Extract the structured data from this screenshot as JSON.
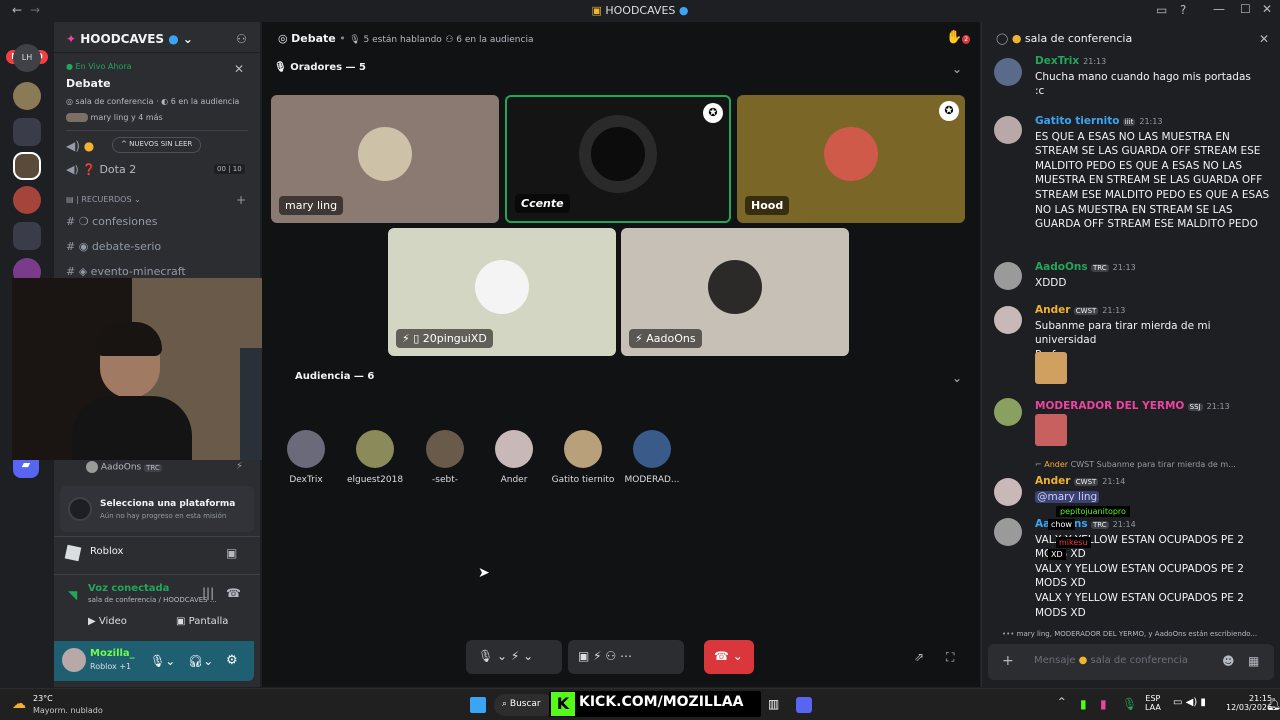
{
  "window": {
    "title": "HOODCAVES",
    "icons": [
      "back-arrow",
      "forward-arrow",
      "inbox-icon",
      "help-icon",
      "minimize",
      "maximize",
      "close"
    ]
  },
  "guilds": {
    "new_badge": "NUEVO",
    "unread_badge": "LH"
  },
  "sidebar": {
    "server_name": "HOODCAVES",
    "live_label": "En Vivo Ahora",
    "stage_name": "Debate",
    "stage_channel": "sala de conferencia",
    "stage_audience": "6 en la audiencia",
    "stage_members": "mary ling y 4 más",
    "new_unread": "NUEVOS SIN LEER",
    "dota": "Dota 2",
    "dota_count_a": "00",
    "dota_count_b": "10",
    "category": "| RECUERDOS",
    "channels": [
      "confesiones",
      "debate-serio",
      "evento-minecraft"
    ],
    "voice_user": "AadoOns",
    "voice_user_tag": "TRC",
    "platform_title": "Selecciona una plataforma",
    "platform_sub": "Aún no hay progreso en esta misión",
    "game": "Roblox",
    "voice_status": "Voz conectada",
    "voice_channel": "sala de conferencia / HOODCAVES ...",
    "video_btn": "Video",
    "screen_btn": "Pantalla",
    "self_name": "Mozilla_",
    "self_status": "Roblox +1"
  },
  "stage": {
    "title": "Debate",
    "speaking": "5 están hablando",
    "audience": "6 en la audiencia",
    "speakers_header": "Oradores — 5",
    "audience_header": "Audiencia — 6",
    "speakers": [
      "mary ling",
      "Ccente",
      "Hood",
      "20pinguiXD",
      "AadoOns"
    ],
    "audience_list": [
      "DexTrix",
      "elguest2018",
      "-sebt-",
      "Ander",
      "Gatito tiernito",
      "MODERAD..."
    ]
  },
  "chat": {
    "header": "sala de conferencia",
    "messages": [
      {
        "user": "DexTrix",
        "time": "21:13",
        "lines": [
          "Chucha mano cuando hago mis portadas",
          ":c"
        ]
      },
      {
        "user": "Gatito tiernito",
        "tag": "iiit",
        "time": "21:13",
        "text": "ES QUE A ESAS NO LAS MUESTRA EN STREAM SE LAS GUARDA OFF STREAM ESE MALDITO PEDO ES QUE A ESAS NO LAS MUESTRA EN STREAM SE LAS GUARDA OFF STREAM ESE MALDITO PEDO ES QUE A ESAS NO LAS MUESTRA EN STREAM SE LAS GUARDA OFF STREAM ESE MALDITO PEDO"
      },
      {
        "user": "AadoOns",
        "tag": "TRC",
        "time": "21:13",
        "text": "XDDD"
      },
      {
        "user": "Ander",
        "tag": "CWST",
        "time": "21:13",
        "lines": [
          "Subanme para tirar mierda de mi universidad",
          "Porfa"
        ]
      },
      {
        "user": "MODERADOR DEL YERMO",
        "tag": "SSJ",
        "time": "21:13"
      },
      {
        "reply_user": "Ander",
        "reply_tag": "CWST",
        "reply_text": "Subanme para tirar mierda de m...",
        "user": "Ander",
        "tag": "CWST",
        "time": "21:14",
        "text": "@mary ling"
      },
      {
        "user": "AadoOns",
        "tag": "TRC",
        "time": "21:14",
        "lines": [
          "VALX Y YELLOW ESTAN OCUPADOS PE 2 MODS XD",
          "VALX Y YELLOW ESTAN OCUPADOS PE 2 MODS XD",
          "VALX Y YELLOW ESTAN OCUPADOS PE 2 MODS XD"
        ]
      }
    ],
    "overlay_names": [
      "pepitojuanitopro",
      "chow",
      "mikesu",
      "XD"
    ],
    "typing": "mary ling, MODERADOR DEL YERMO, y AadoOns están escribiendo...",
    "input_placeholder": "Mensaje",
    "input_channel": "sala de conferencia"
  },
  "taskbar": {
    "weather_temp": "23°C",
    "weather_desc": "Mayorm. nublado",
    "search": "Buscar",
    "kick": "KICK.COM/MOZILLAA",
    "lang": "ESP",
    "lang2": "LAA",
    "time": "21:15",
    "date": "12/03/2026"
  },
  "colors": {
    "accent": "#5865f2",
    "green": "#23a55a",
    "red": "#da373c",
    "bronze": "#7a6627",
    "kick": "#53fc18"
  }
}
